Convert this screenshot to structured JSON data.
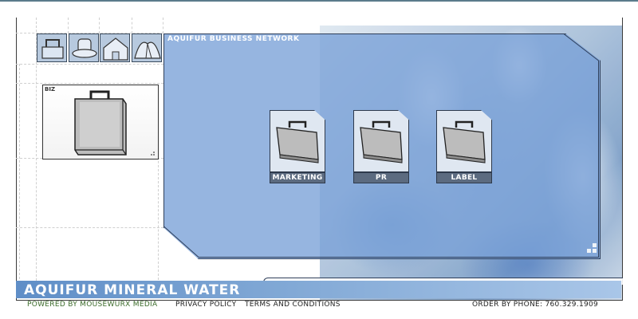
{
  "header": {
    "panel_title": "AQUIFUR BUSINESS NETWORK"
  },
  "nav_icons": [
    {
      "name": "briefcase-handle-icon"
    },
    {
      "name": "hat-icon"
    },
    {
      "name": "house-icon"
    },
    {
      "name": "tent-icon"
    }
  ],
  "biz_box": {
    "label": "BIZ",
    "icon": "briefcase-icon"
  },
  "cards": [
    {
      "label": "MARKETING",
      "icon": "briefcase-icon"
    },
    {
      "label": "PR",
      "icon": "briefcase-icon"
    },
    {
      "label": "LABEL",
      "icon": "briefcase-icon"
    }
  ],
  "brand": {
    "title": "AQUIFUR MINERAL WATER"
  },
  "footer": {
    "powered": "POWERED BY MOUSEWURX MEDIA",
    "privacy": "PRIVACY POLICY",
    "terms": "TERMS AND CONDITIONS",
    "order": "ORDER BY PHONE: 760.329.1909"
  },
  "colors": {
    "panel_blue": "#78a0d7",
    "nav_icon_bg": "#b7c9de",
    "card_label_bg": "#5c6b80",
    "powered_green": "#3b6b2a"
  }
}
